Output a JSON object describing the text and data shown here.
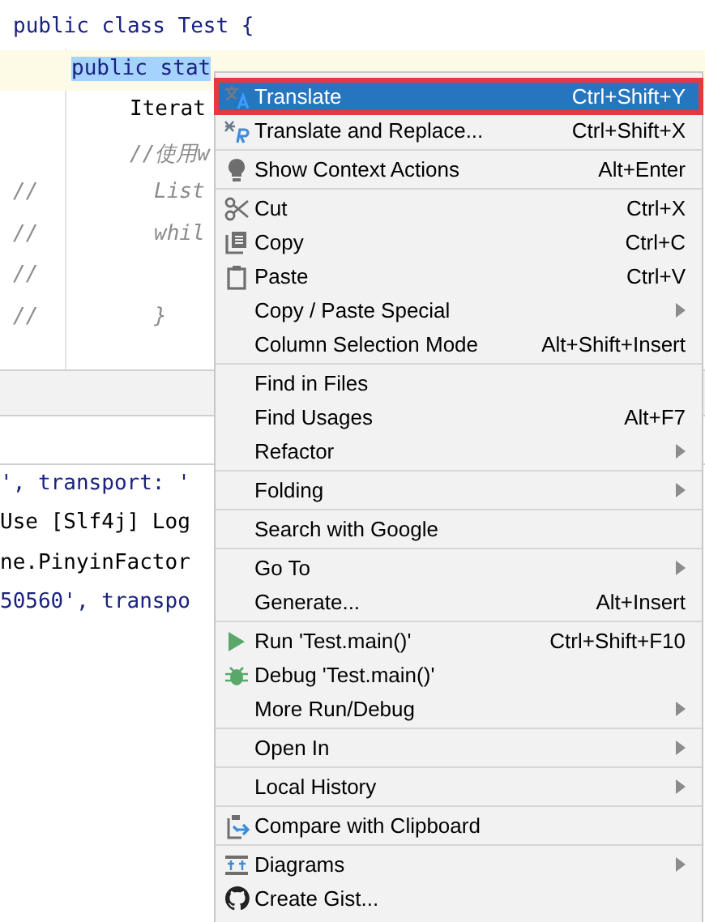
{
  "editor": {
    "lines": [
      {
        "kind": "code",
        "text": "public class Test {",
        "current": false
      },
      {
        "kind": "code",
        "selection": "public stat",
        "current": true
      },
      {
        "kind": "plain",
        "text": "Iterat",
        "current": false
      },
      {
        "kind": "comment",
        "text": "//使用w",
        "current": false
      },
      {
        "kind": "comment",
        "gutter": "//",
        "text": "List",
        "current": false
      },
      {
        "kind": "comment",
        "gutter": "//",
        "text": "whil",
        "current": false
      },
      {
        "gutter": "//",
        "current": false
      },
      {
        "kind": "comment",
        "gutter": "//",
        "text": "}",
        "current": false
      }
    ]
  },
  "console": {
    "lines": [
      {
        "kind": "info",
        "text": "', transport: '"
      },
      {
        "kind": "plain",
        "text": "Use [Slf4j] Log"
      },
      {
        "kind": "plain",
        "text": "ne.PinyinFactor"
      },
      {
        "kind": "info",
        "text": "50560', transpo"
      }
    ]
  },
  "context_menu": {
    "groups": [
      [
        {
          "label": "Translate",
          "shortcut": "Ctrl+Shift+Y",
          "submenu": false,
          "selected": true,
          "annotated": true
        },
        {
          "label": "Translate and Replace...",
          "shortcut": "Ctrl+Shift+X",
          "submenu": false,
          "selected": false,
          "annotated": false
        }
      ],
      [
        {
          "label": "Show Context Actions",
          "shortcut": "Alt+Enter",
          "submenu": false,
          "selected": false,
          "annotated": false
        }
      ],
      [
        {
          "label": "Cut",
          "shortcut": "Ctrl+X",
          "submenu": false,
          "selected": false,
          "annotated": false
        },
        {
          "label": "Copy",
          "shortcut": "Ctrl+C",
          "submenu": false,
          "selected": false,
          "annotated": false
        },
        {
          "label": "Paste",
          "shortcut": "Ctrl+V",
          "submenu": false,
          "selected": false,
          "annotated": false
        },
        {
          "label": "Copy / Paste Special",
          "submenu": true,
          "selected": false,
          "annotated": false
        },
        {
          "label": "Column Selection Mode",
          "shortcut": "Alt+Shift+Insert",
          "submenu": false,
          "selected": false,
          "annotated": false
        }
      ],
      [
        {
          "label": "Find in Files",
          "submenu": false,
          "selected": false,
          "annotated": false
        },
        {
          "label": "Find Usages",
          "shortcut": "Alt+F7",
          "submenu": false,
          "selected": false,
          "annotated": false
        },
        {
          "label": "Refactor",
          "submenu": true,
          "selected": false,
          "annotated": false
        }
      ],
      [
        {
          "label": "Folding",
          "submenu": true,
          "selected": false,
          "annotated": false
        }
      ],
      [
        {
          "label": "Search with Google",
          "submenu": false,
          "selected": false,
          "annotated": false
        }
      ],
      [
        {
          "label": "Go To",
          "submenu": true,
          "selected": false,
          "annotated": false
        },
        {
          "label": "Generate...",
          "shortcut": "Alt+Insert",
          "submenu": false,
          "selected": false,
          "annotated": false
        }
      ],
      [
        {
          "label": "Run 'Test.main()'",
          "shortcut": "Ctrl+Shift+F10",
          "submenu": false,
          "selected": false,
          "annotated": false
        },
        {
          "label": "Debug 'Test.main()'",
          "submenu": false,
          "selected": false,
          "annotated": false
        },
        {
          "label": "More Run/Debug",
          "submenu": true,
          "selected": false,
          "annotated": false
        }
      ],
      [
        {
          "label": "Open In",
          "submenu": true,
          "selected": false,
          "annotated": false
        }
      ],
      [
        {
          "label": "Local History",
          "submenu": true,
          "selected": false,
          "annotated": false
        }
      ],
      [
        {
          "label": "Compare with Clipboard",
          "submenu": false,
          "selected": false,
          "annotated": false
        }
      ],
      [
        {
          "label": "Diagrams",
          "submenu": true,
          "selected": false,
          "annotated": false
        },
        {
          "label": "Create Gist...",
          "submenu": false,
          "selected": false,
          "annotated": false
        }
      ]
    ]
  }
}
